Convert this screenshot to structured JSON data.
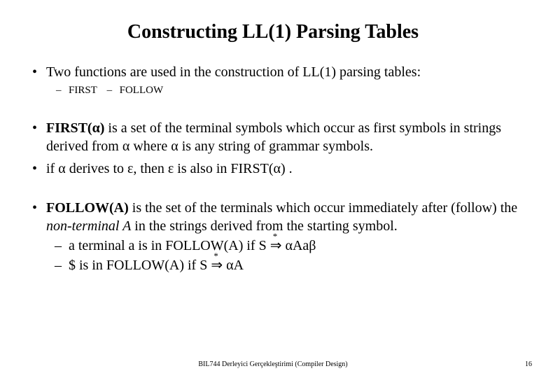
{
  "title": "Constructing LL(1) Parsing Tables",
  "bullet1": "Two functions are used in the construction of LL(1) parsing tables:",
  "sub1a": "FIRST",
  "sub1b": "FOLLOW",
  "bullet2_lead": "FIRST(",
  "alpha": "α",
  "bullet2_close": ")",
  "bullet2_rest1": " is a set of the terminal symbols which occur as first symbols in strings derived from ",
  "bullet2_rest2": " where ",
  "bullet2_rest3": " is any string of grammar symbols.",
  "bullet3_a": "if ",
  "bullet3_b": " derives to ",
  "eps": "ε",
  "bullet3_c": ", then ",
  "bullet3_d": " is also in FIRST(",
  "bullet3_e": ") .",
  "bullet4_lead": "FOLLOW(A)",
  "bullet4_rest1": " is the set of the terminals which occur immediately after (follow)  the ",
  "nonterm": "non-terminal A",
  "bullet4_rest2": "  in the strings derived from the starting symbol.",
  "dash1_a": "a terminal a is in FOLLOW(A)   if   S ",
  "dash1_b": " ",
  "dash1_c": "Aa",
  "beta": "β",
  "dash2_a": "$ is in FOLLOW(A)     if   S ",
  "dash2_b": " ",
  "dash2_c": "A",
  "darrow_glyph": "⇒",
  "star": "*",
  "footer": "BIL744 Derleyici Gerçekleştirimi (Compiler Design)",
  "pagenum": "16"
}
